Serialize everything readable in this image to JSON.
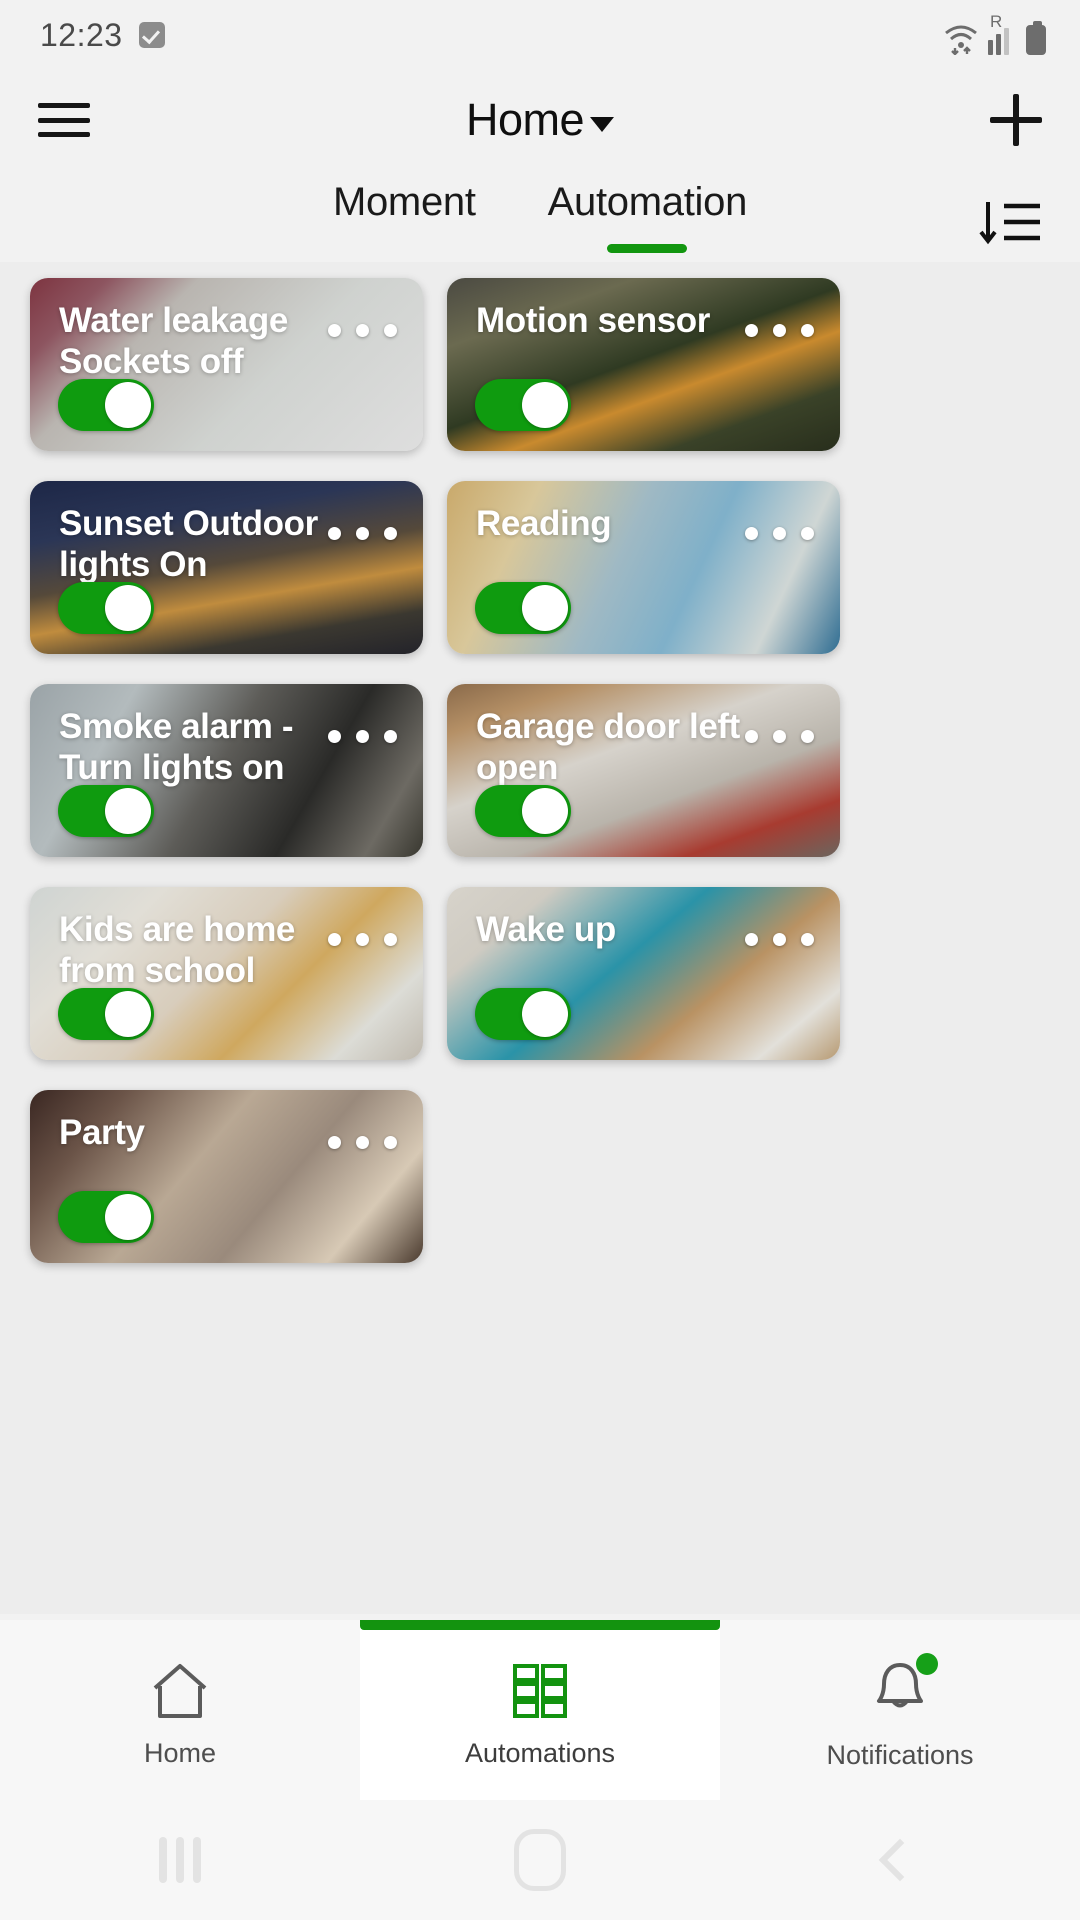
{
  "status_bar": {
    "time": "12:23",
    "icons": [
      "checkbox-icon",
      "wifi-icon",
      "roaming-signal-icon",
      "battery-icon"
    ],
    "roaming_letter": "R"
  },
  "app_bar": {
    "menu_icon": "hamburger-menu-icon",
    "title": "Home",
    "dropdown_icon": "chevron-down-icon",
    "add_icon": "plus-icon"
  },
  "tabs": {
    "items": [
      {
        "label": "Moment",
        "active": false
      },
      {
        "label": "Automation",
        "active": true
      }
    ],
    "sort_icon": "sort-descending-icon",
    "active_color": "#12960f"
  },
  "automations": [
    {
      "title": "Water leakage Sockets off",
      "enabled": true,
      "menu": "more-options-icon"
    },
    {
      "title": "Motion sensor",
      "enabled": true,
      "menu": "more-options-icon"
    },
    {
      "title": "Sunset Outdoor lights On",
      "enabled": true,
      "menu": "more-options-icon"
    },
    {
      "title": "Reading",
      "enabled": true,
      "menu": "more-options-icon"
    },
    {
      "title": "Smoke alarm - Turn lights on",
      "enabled": true,
      "menu": "more-options-icon"
    },
    {
      "title": "Garage door left open",
      "enabled": true,
      "menu": "more-options-icon"
    },
    {
      "title": "Kids are home from school",
      "enabled": true,
      "menu": "more-options-icon"
    },
    {
      "title": "Wake up",
      "enabled": true,
      "menu": "more-options-icon"
    },
    {
      "title": "Party",
      "enabled": true,
      "menu": "more-options-icon"
    }
  ],
  "toggle_color": "#0f9b0f",
  "bottom_nav": {
    "items": [
      {
        "label": "Home",
        "icon": "home-icon",
        "active": false,
        "badge": false
      },
      {
        "label": "Automations",
        "icon": "grid-icon",
        "active": true,
        "badge": false
      },
      {
        "label": "Notifications",
        "icon": "bell-icon",
        "active": false,
        "badge": true
      }
    ],
    "badge_color": "#16a018"
  },
  "system_nav": {
    "recent_icon": "recent-apps-icon",
    "home_icon": "home-pill-icon",
    "back_icon": "back-chevron-icon"
  }
}
